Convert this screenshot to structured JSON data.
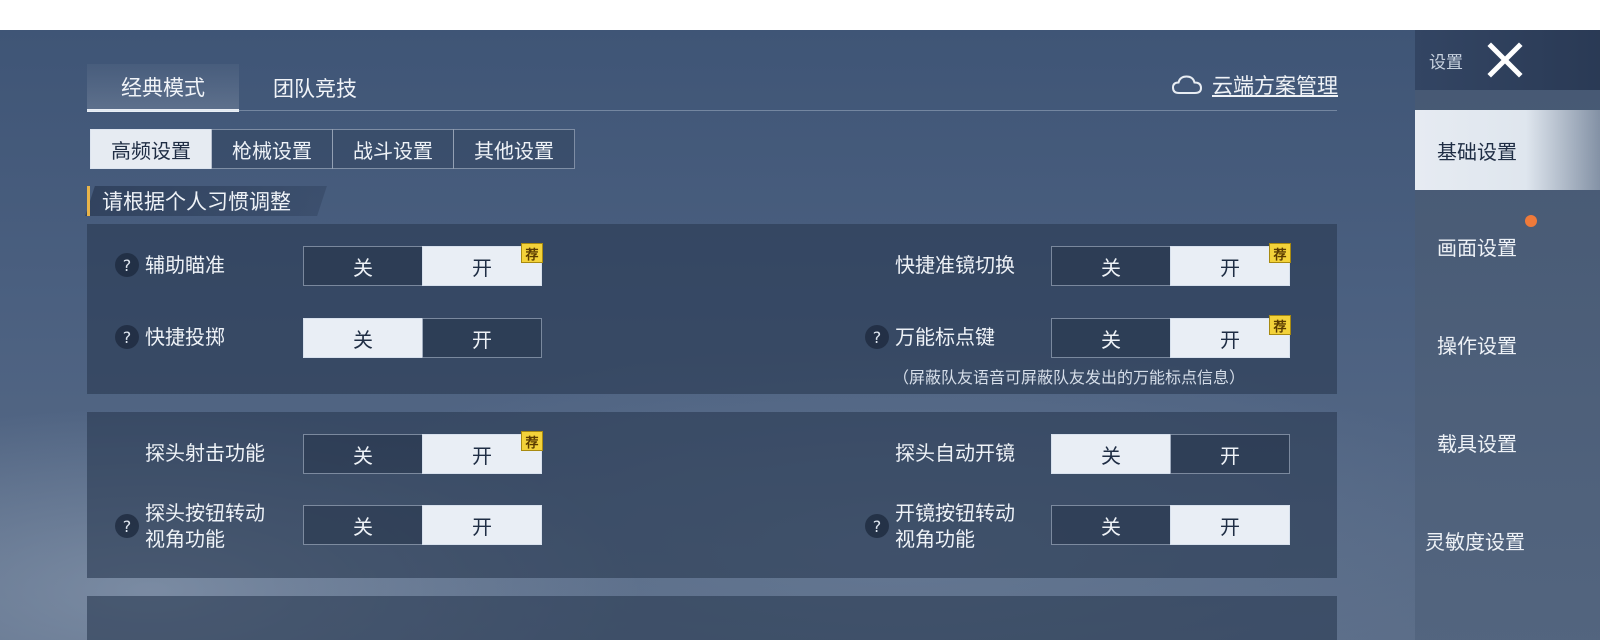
{
  "mode_tabs": [
    {
      "label": "经典模式",
      "active": true
    },
    {
      "label": "团队竞技",
      "active": false
    }
  ],
  "cloud_link": {
    "label": "云端方案管理",
    "icon": "cloud-icon"
  },
  "sub_tabs": [
    {
      "label": "高频设置",
      "active": true
    },
    {
      "label": "枪械设置",
      "active": false
    },
    {
      "label": "战斗设置",
      "active": false
    },
    {
      "label": "其他设置",
      "active": false
    }
  ],
  "hint": "请根据个人习惯调整",
  "toggle_labels": {
    "off": "关",
    "on": "开"
  },
  "recommend_badge": "荐",
  "settings": {
    "aim_assist": {
      "label": "辅助瞄准",
      "help": true,
      "value": "on",
      "recommended": true
    },
    "quick_throw": {
      "label": "快捷投掷",
      "help": true,
      "value": "off",
      "recommended": false
    },
    "quick_scope_switch": {
      "label": "快捷准镜切换",
      "help": false,
      "value": "on",
      "recommended": true
    },
    "universal_marker": {
      "label": "万能标点键",
      "help": true,
      "value": "on",
      "recommended": true,
      "note": "（屏蔽队友语音可屏蔽队友发出的万能标点信息）"
    },
    "peek_fire": {
      "label": "探头射击功能",
      "help": false,
      "value": "on",
      "recommended": true
    },
    "peek_button_rotate": {
      "label1": "探头按钮转动",
      "label2": "视角功能",
      "help": true,
      "value": "on",
      "recommended": false
    },
    "peek_auto_scope": {
      "label": "探头自动开镜",
      "help": false,
      "value": "off",
      "recommended": false
    },
    "scope_button_rotate": {
      "label1": "开镜按钮转动",
      "label2": "视角功能",
      "help": true,
      "value": "on",
      "recommended": false
    }
  },
  "help_glyph": "?",
  "sidebar": {
    "title": "设置",
    "items": [
      {
        "label": "基础设置",
        "active": true
      },
      {
        "label": "画面设置",
        "active": false,
        "has_dot": true
      },
      {
        "label": "操作设置",
        "active": false
      },
      {
        "label": "载具设置",
        "active": false
      },
      {
        "label": "灵敏度设置",
        "active": false
      }
    ]
  },
  "colors": {
    "accent_bar": "#e8b44a",
    "badge": "#f3d23a",
    "notify_dot": "#ef7a3a"
  }
}
